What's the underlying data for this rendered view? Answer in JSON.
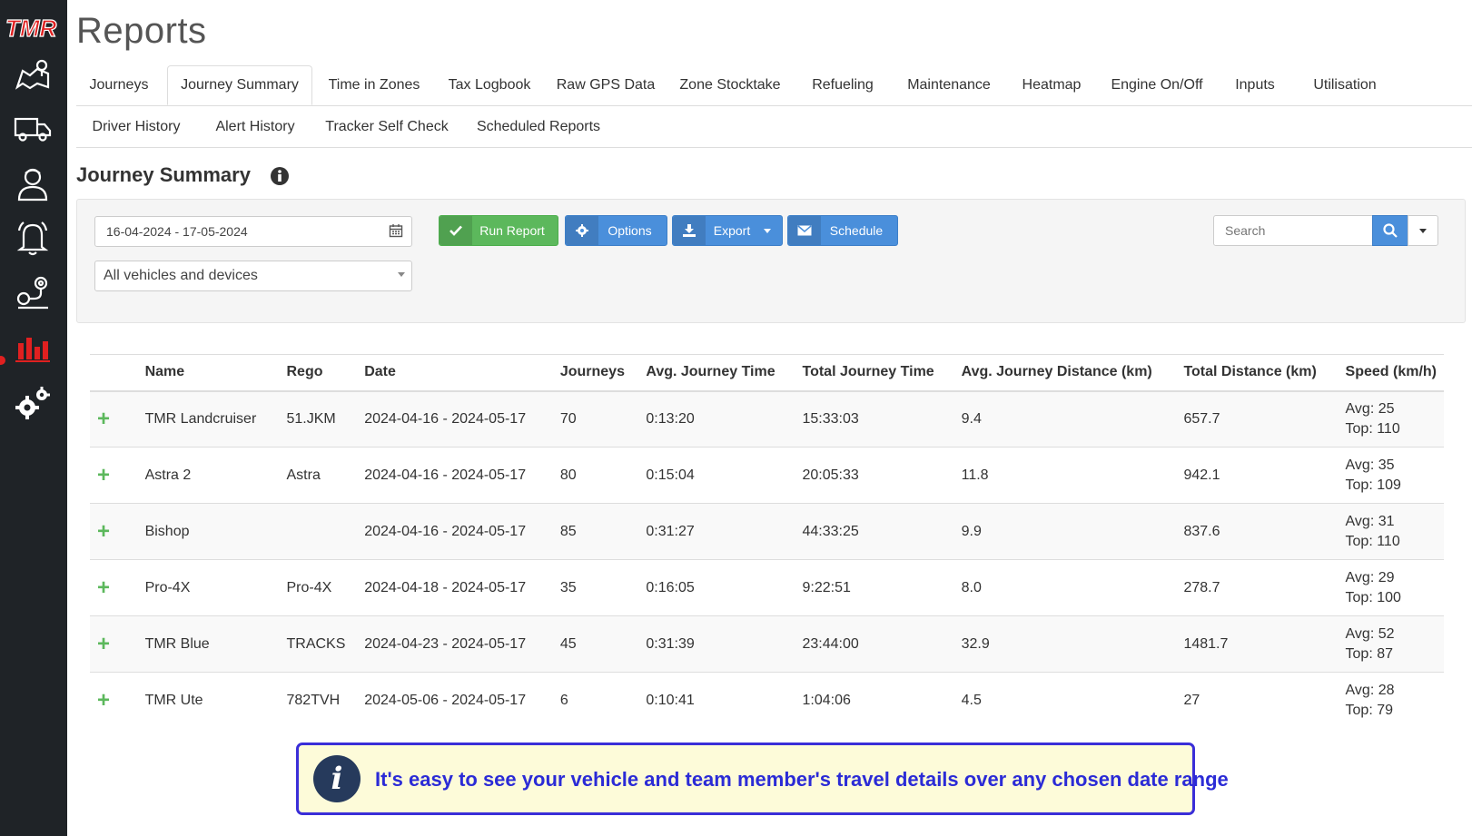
{
  "app": {
    "logo_text": "TMR",
    "accent": "#e02020"
  },
  "sidebar": {
    "items": [
      {
        "icon": "map-icon"
      },
      {
        "icon": "truck-icon"
      },
      {
        "icon": "driver-icon"
      },
      {
        "icon": "bell-icon"
      },
      {
        "icon": "route-pin-icon"
      },
      {
        "icon": "bar-chart-icon",
        "active": true
      },
      {
        "icon": "gears-icon"
      }
    ]
  },
  "page": {
    "title": "Reports"
  },
  "tabs": {
    "row1": [
      "Journeys",
      "Journey Summary",
      "Time in Zones",
      "Tax Logbook",
      "Raw GPS Data",
      "Zone Stocktake",
      "Refueling",
      "Maintenance",
      "Heatmap",
      "Engine On/Off",
      "Inputs",
      "Utilisation"
    ],
    "row2": [
      "Driver History",
      "Alert History",
      "Tracker Self Check",
      "Scheduled Reports"
    ],
    "active": "Journey Summary"
  },
  "section": {
    "title": "Journey Summary"
  },
  "filters": {
    "date_range": "16-04-2024 - 17-05-2024",
    "vehicle_select": "All vehicles and devices",
    "run_report": "Run Report",
    "options": "Options",
    "export": "Export",
    "schedule": "Schedule",
    "search_placeholder": "Search"
  },
  "table": {
    "headers": [
      "",
      "Name",
      "Rego",
      "Date",
      "Journeys",
      "Avg. Journey Time",
      "Total Journey Time",
      "Avg. Journey Distance (km)",
      "Total Distance (km)",
      "Speed (km/h)"
    ],
    "rows": [
      {
        "name": "TMR Landcruiser",
        "rego": "51.JKM",
        "date": "2024-04-16 - 2024-05-17",
        "journeys": "70",
        "avg_time": "0:13:20",
        "total_time": "15:33:03",
        "avg_dist": "9.4",
        "total_dist": "657.7",
        "speed_avg": "Avg: 25",
        "speed_top": "Top: 110"
      },
      {
        "name": "Astra 2",
        "rego": "Astra",
        "date": "2024-04-16 - 2024-05-17",
        "journeys": "80",
        "avg_time": "0:15:04",
        "total_time": "20:05:33",
        "avg_dist": "11.8",
        "total_dist": "942.1",
        "speed_avg": "Avg: 35",
        "speed_top": "Top: 109"
      },
      {
        "name": "Bishop",
        "rego": "",
        "date": "2024-04-16 - 2024-05-17",
        "journeys": "85",
        "avg_time": "0:31:27",
        "total_time": "44:33:25",
        "avg_dist": "9.9",
        "total_dist": "837.6",
        "speed_avg": "Avg: 31",
        "speed_top": "Top: 110"
      },
      {
        "name": "Pro-4X",
        "rego": "Pro-4X",
        "date": "2024-04-18 - 2024-05-17",
        "journeys": "35",
        "avg_time": "0:16:05",
        "total_time": "9:22:51",
        "avg_dist": "8.0",
        "total_dist": "278.7",
        "speed_avg": "Avg: 29",
        "speed_top": "Top: 100"
      },
      {
        "name": "TMR Blue",
        "rego": "TRACKS",
        "date": "2024-04-23 - 2024-05-17",
        "journeys": "45",
        "avg_time": "0:31:39",
        "total_time": "23:44:00",
        "avg_dist": "32.9",
        "total_dist": "1481.7",
        "speed_avg": "Avg: 52",
        "speed_top": "Top: 87"
      },
      {
        "name": "TMR Ute",
        "rego": "782TVH",
        "date": "2024-05-06 - 2024-05-17",
        "journeys": "6",
        "avg_time": "0:10:41",
        "total_time": "1:04:06",
        "avg_dist": "4.5",
        "total_dist": "27",
        "speed_avg": "Avg: 28",
        "speed_top": "Top: 79"
      }
    ]
  },
  "banner": {
    "text": "It's easy to see your vehicle and team member's travel details over any chosen date range"
  }
}
